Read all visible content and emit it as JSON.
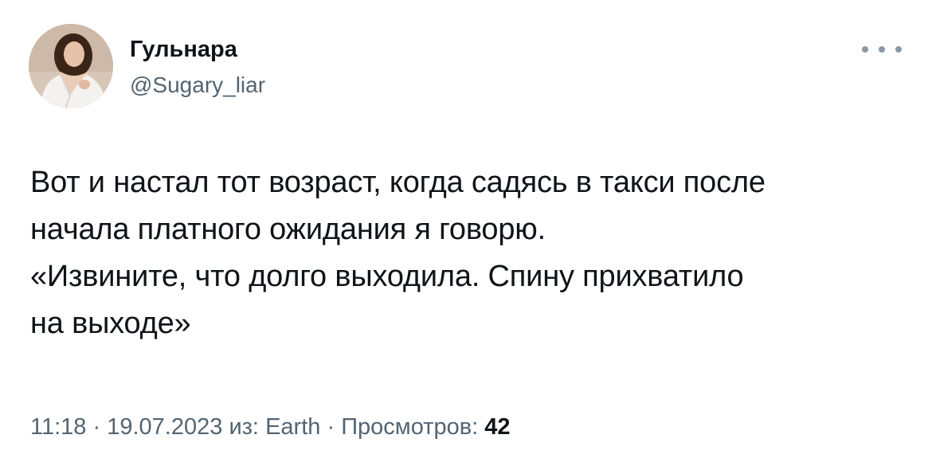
{
  "author": {
    "display_name": "Гульнара",
    "handle": "@Sugary_liar"
  },
  "tweet": {
    "text": "Вот и настал тот возраст, когда садясь в такси после\nначала платного ожидания я говорю.\n«Извините, что долго выходила. Спину прихватило\nна выходе»"
  },
  "meta": {
    "time": "11:18",
    "separator": "·",
    "date": "19.07.2023",
    "source_prefix": "из:",
    "source": "Earth",
    "views_label": "Просмотров:",
    "views_count": "42"
  },
  "icons": {
    "more": "more-horizontal-icon"
  },
  "colors": {
    "primary_text": "#0f1419",
    "secondary_text": "#536471"
  }
}
